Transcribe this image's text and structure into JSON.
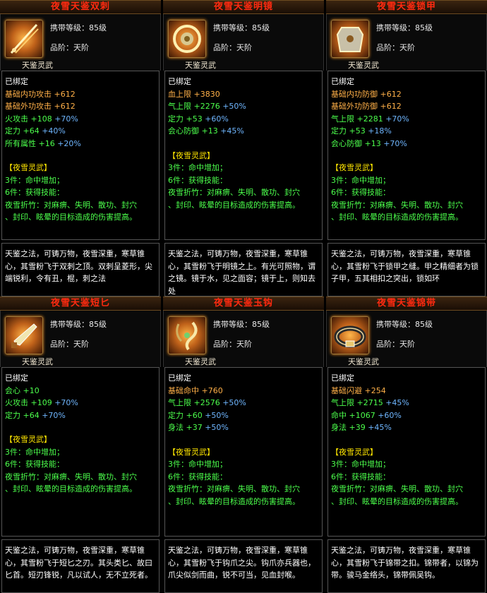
{
  "cards": [
    {
      "title": "夜雪天鉴双刺",
      "icon": "twin-dagger-icon",
      "req": "携带等级：85级",
      "grade": "品阶：天阶",
      "subtitle": "天鉴灵武",
      "bound": "已绑定",
      "stats": [
        {
          "label": "基础内功攻击",
          "value": "+612",
          "bonus": ""
        },
        {
          "label": "基础外功攻击",
          "value": "+612",
          "bonus": ""
        },
        {
          "label": "火攻击",
          "value": "+108",
          "bonus": "+70%"
        },
        {
          "label": "定力",
          "value": "+64",
          "bonus": "+40%"
        },
        {
          "label": "所有属性",
          "value": "+16",
          "bonus": "+20%"
        }
      ],
      "set_name": "【夜雪灵武】",
      "set3": "3件：命中增加；",
      "set6": "6件：获得技能：",
      "skill_a": "夜雪折竹：对麻痹、失明、散功、封穴",
      "skill_b": "、封印、眩晕的目标造成的伤害提高。",
      "desc": "天鉴之法，可铸万物，夜雪深重，寒草锥心，其雪粉飞于双刺之顶。双刺呈菱形，尖端锐利，令有丑，棍，刺之法"
    },
    {
      "title": "夜雪天鉴明镜",
      "icon": "mirror-icon",
      "req": "携带等级：85级",
      "grade": "品阶：天阶",
      "subtitle": "天鉴灵武",
      "bound": "已绑定",
      "stats": [
        {
          "label": "血上限",
          "value": "+3830",
          "bonus": ""
        },
        {
          "label": "气上限",
          "value": "+2276",
          "bonus": "+50%"
        },
        {
          "label": "定力",
          "value": "+53",
          "bonus": "+60%"
        },
        {
          "label": "会心防御",
          "value": "+13",
          "bonus": "+45%"
        }
      ],
      "set_name": "【夜雪灵武】",
      "set3": "3件：命中增加；",
      "set6": "6件：获得技能：",
      "skill_a": "夜雪折竹：对麻痹、失明、散功、封穴",
      "skill_b": "、封印、眩晕的目标造成的伤害提高。",
      "desc": "天鉴之法，可铸万物，夜雪深重，寒草锥心，其雪粉飞于明镜之上。有光可照物，谓之镜。镜于水，见之面容；镜于上，则知去处"
    },
    {
      "title": "夜雪天鉴锁甲",
      "icon": "armor-icon",
      "req": "携带等级：85级",
      "grade": "品阶：天阶",
      "subtitle": "天鉴灵武",
      "bound": "已绑定",
      "stats": [
        {
          "label": "基础内功防御",
          "value": "+612",
          "bonus": ""
        },
        {
          "label": "基础外功防御",
          "value": "+612",
          "bonus": ""
        },
        {
          "label": "气上限",
          "value": "+2281",
          "bonus": "+70%"
        },
        {
          "label": "定力",
          "value": "+53",
          "bonus": "+18%"
        },
        {
          "label": "会心防御",
          "value": "+13",
          "bonus": "+70%"
        }
      ],
      "set_name": "【夜雪灵武】",
      "set3": "3件：命中增加；",
      "set6": "6件：获得技能：",
      "skill_a": "夜雪折竹：对麻痹、失明、散功、封穴",
      "skill_b": "、封印、眩晕的目标造成的伤害提高。",
      "desc": "天鉴之法，可铸万物，夜雪深重，寒草锥心，其雪粉飞于锁甲之缝。甲之精细者为锁子甲，五其相扣之突出，锁如环"
    },
    {
      "title": "夜雪天鉴短匕",
      "icon": "short-dagger-icon",
      "req": "携带等级：85级",
      "grade": "品阶：天阶",
      "subtitle": "天鉴灵武",
      "bound": "已绑定",
      "stats": [
        {
          "label": "会心",
          "value": "+10",
          "bonus": ""
        },
        {
          "label": "火攻击",
          "value": "+109",
          "bonus": "+70%"
        },
        {
          "label": "定力",
          "value": "+64",
          "bonus": "+70%"
        }
      ],
      "set_name": "【夜雪灵武】",
      "set3": "3件：命中增加；",
      "set6": "6件：获得技能：",
      "skill_a": "夜雪折竹：对麻痹、失明、散功、封穴",
      "skill_b": "、封印、眩晕的目标造成的伤害提高。",
      "desc": "天鉴之法，可铸万物，夜雪深重，寒草锥心，其雪粉飞于短匕之刃。其头类匕、故曰匕首。短刃锋锐，凡以试人，无不立死者。"
    },
    {
      "title": "夜雪天鉴玉钩",
      "icon": "jade-hook-icon",
      "req": "携带等级：85级",
      "grade": "品阶：天阶",
      "subtitle": "天鉴灵武",
      "bound": "已绑定",
      "stats": [
        {
          "label": "基础命中",
          "value": "+760",
          "bonus": ""
        },
        {
          "label": "气上限",
          "value": "+2576",
          "bonus": "+50%"
        },
        {
          "label": "定力",
          "value": "+60",
          "bonus": "+50%"
        },
        {
          "label": "身法",
          "value": "+37",
          "bonus": "+50%"
        }
      ],
      "set_name": "【夜雪灵武】",
      "set3": "3件：命中增加；",
      "set6": "6件：获得技能：",
      "skill_a": "夜雪折竹：对麻痹、失明、散功、封穴",
      "skill_b": "、封印、眩晕的目标造成的伤害提高。",
      "desc": "天鉴之法，可铸万物，夜雪深重，寒草锥心，其雪粉飞于钩爪之尖。钩爪亦兵器也，爪尖似剑而曲，锐不可当，见血封喉。"
    },
    {
      "title": "夜雪天鉴锦带",
      "icon": "belt-icon",
      "req": "携带等级：85级",
      "grade": "品阶：天阶",
      "subtitle": "天鉴灵武",
      "bound": "已绑定",
      "stats": [
        {
          "label": "基础闪避",
          "value": "+254",
          "bonus": ""
        },
        {
          "label": "气上限",
          "value": "+2715",
          "bonus": "+45%"
        },
        {
          "label": "命中",
          "value": "+1067",
          "bonus": "+60%"
        },
        {
          "label": "身法",
          "value": "+39",
          "bonus": "+45%"
        }
      ],
      "set_name": "【夜雪灵武】",
      "set3": "3件：命中增加；",
      "set6": "6件：获得技能：",
      "skill_a": "夜雪折竹：对麻痹、失明、散功、封穴",
      "skill_b": "、封印、眩晕的目标造成的伤害提高。",
      "desc": "天鉴之法，可铸万物，夜雪深重，寒草锥心，其雪粉飞于锦带之扣。锦带者，以锦为带。骏马金络头，锦带佩吴钩。"
    }
  ]
}
